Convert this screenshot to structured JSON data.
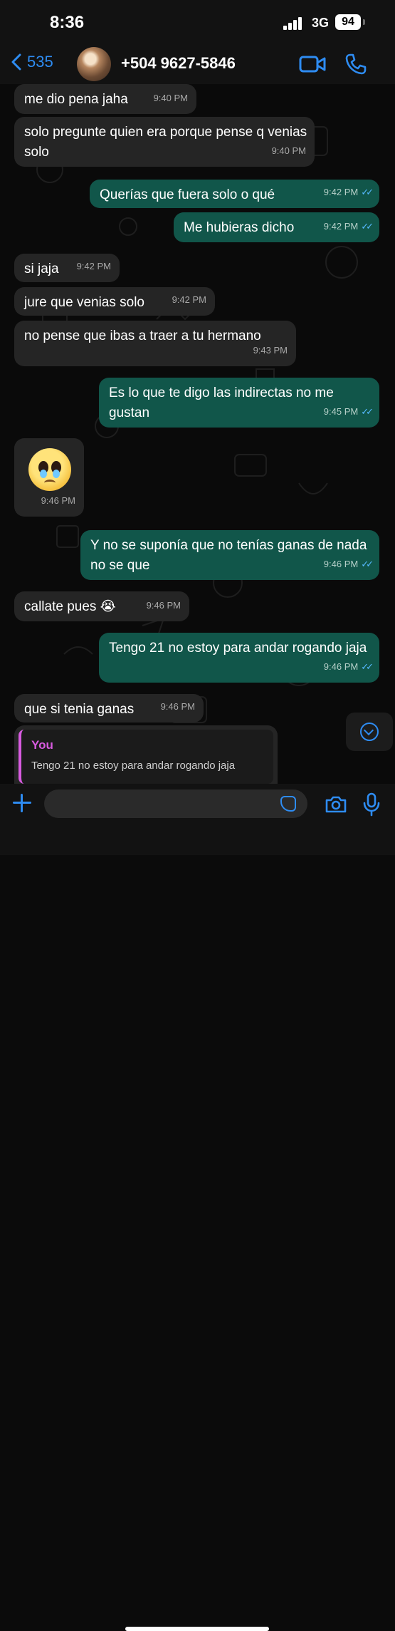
{
  "status": {
    "time": "8:36",
    "network": "3G",
    "battery": "94"
  },
  "header": {
    "back_count": "535",
    "contact": "+504 9627-5846"
  },
  "messages": [
    {
      "dir": "in",
      "text": "me dio pena jaha",
      "time": "9:40 PM"
    },
    {
      "dir": "in",
      "text": "solo pregunte quien era porque pense q venias solo",
      "time": "9:40 PM"
    },
    {
      "dir": "out",
      "text": "Querías que fuera solo o qué",
      "time": "9:42 PM"
    },
    {
      "dir": "out",
      "text": "Me hubieras dicho",
      "time": "9:42 PM"
    },
    {
      "dir": "in",
      "text": "si jaja",
      "time": "9:42 PM"
    },
    {
      "dir": "in",
      "text": "jure que venias solo",
      "time": "9:42 PM"
    },
    {
      "dir": "in",
      "text": "no pense que ibas a traer a tu hermano",
      "time": "9:43 PM"
    },
    {
      "dir": "out",
      "text": "Es lo que te digo las indirectas no me gustan",
      "time": "9:45 PM"
    },
    {
      "dir": "in",
      "text": "",
      "emoji": "pleading-face-with-tears",
      "time": "9:46 PM"
    },
    {
      "dir": "out",
      "text": "Y no se suponía que no tenías ganas de nada no se que",
      "time": "9:46 PM"
    },
    {
      "dir": "in",
      "text": "callate pues 😭",
      "time": "9:46 PM"
    },
    {
      "dir": "out",
      "text": "Tengo 21 no estoy para andar rogando jaja",
      "time": "9:46 PM"
    },
    {
      "dir": "in",
      "text": "que si tenia ganas",
      "time": "9:46 PM"
    }
  ],
  "reply_preview": {
    "name": "You",
    "text": "Tengo 21 no estoy para andar rogando jaja"
  },
  "composer": {
    "placeholder": ""
  },
  "colors": {
    "accent": "#2e8cf2",
    "incoming": "#252525",
    "outgoing": "#11564a",
    "read_ticks": "#56b9ff",
    "reply_name": "#d85be0"
  }
}
